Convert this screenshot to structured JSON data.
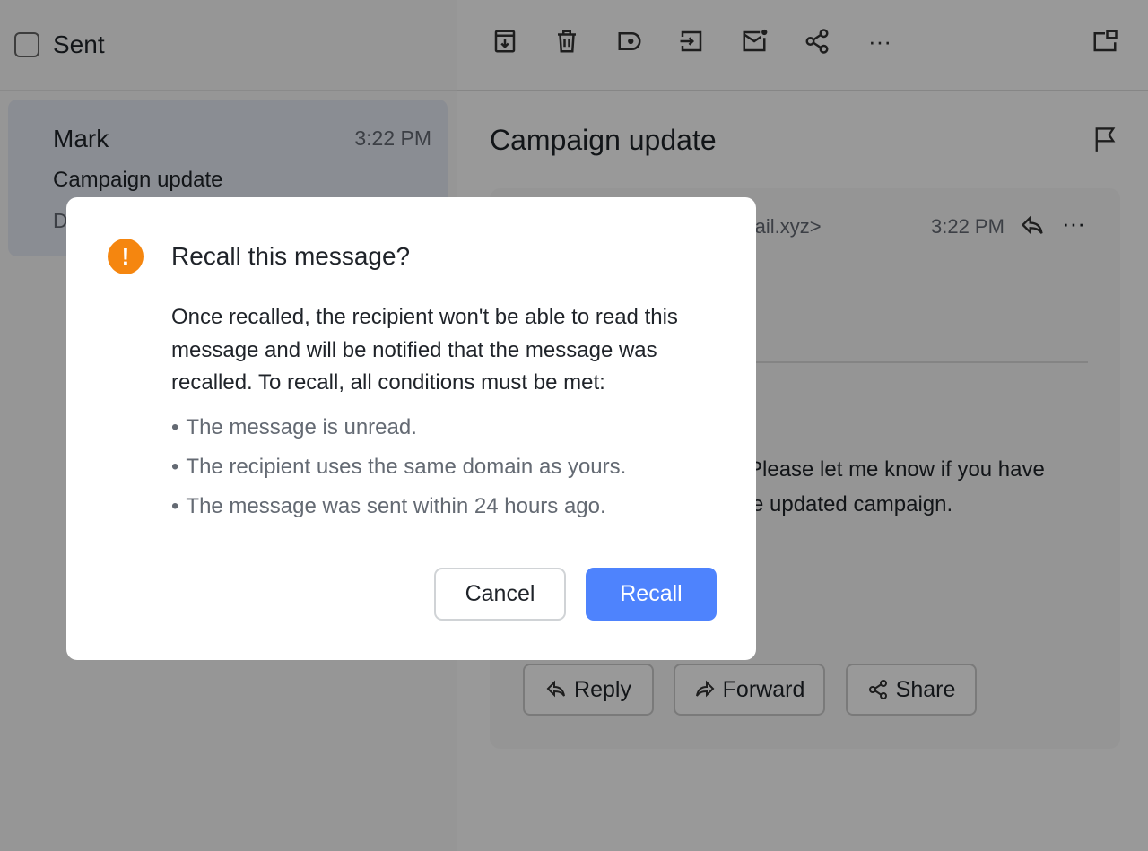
{
  "list": {
    "folder": "Sent",
    "items": [
      {
        "sender": "Mark",
        "time": "3:22 PM",
        "subject": "Campaign update",
        "preview": "D"
      }
    ]
  },
  "toolbar": {
    "icons": [
      "archive-icon",
      "trash-icon",
      "label-icon",
      "move-icon",
      "mark-unread-icon",
      "share-icon",
      "more-icon",
      "popout-icon"
    ]
  },
  "message": {
    "subject": "Campaign update",
    "address_fragment": "-mail.xyz>",
    "time": "3:22 PM",
    "body_fragments": [
      "Please let me know if you have",
      "e updated campaign."
    ],
    "actions": {
      "reply": "Reply",
      "forward": "Forward",
      "share": "Share"
    }
  },
  "dialog": {
    "title": "Recall this message?",
    "text": "Once recalled, the recipient won't be able to read this message and will be notified that the message was recalled. To recall, all conditions must be met:",
    "conditions": [
      "The message is unread.",
      "The recipient uses the same domain as yours.",
      "The message was sent within 24 hours ago."
    ],
    "cancel": "Cancel",
    "confirm": "Recall",
    "warning_color": "#f5860f",
    "accent": "#4e83fd"
  }
}
